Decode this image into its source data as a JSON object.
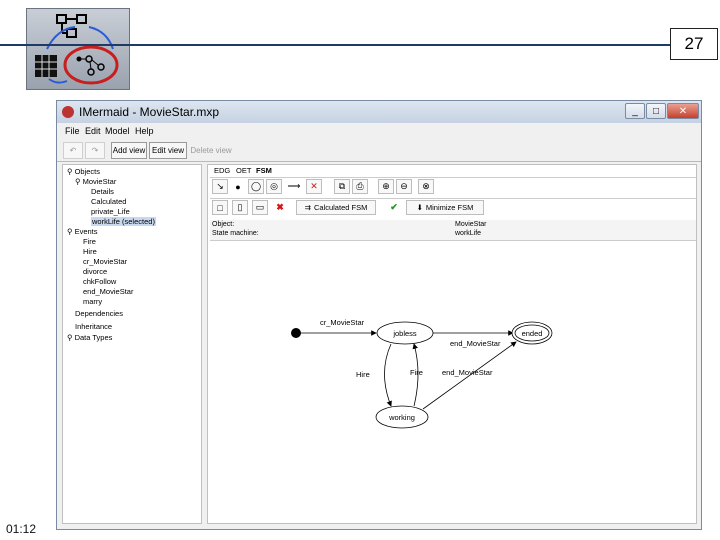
{
  "slide": {
    "page_number": "27",
    "time": "01:12",
    "logo_icon": "fsm-diagram-logo-icon"
  },
  "window": {
    "title": "IMermaid - MovieStar.mxp",
    "controls": {
      "minimize": "_",
      "maximize": "□",
      "close": "✕"
    },
    "menu": [
      "File",
      "Edit",
      "Model",
      "Help"
    ],
    "toolbar": {
      "undo": "↶",
      "redo": "↷",
      "add_view": "Add view",
      "edit_view": "Edit view",
      "delete_view": "Delete view"
    }
  },
  "tree": {
    "objects": "Objects",
    "moviestar": "MovieStar",
    "object_children": [
      "Details",
      "Calculated",
      "private_Life"
    ],
    "selected": "workLife (selected)",
    "events": "Events",
    "event_children": [
      "Fire",
      "Hire",
      "cr_MovieStar",
      "divorce",
      "chkFollow",
      "end_MovieStar",
      "marry"
    ],
    "dependencies": "Dependencies",
    "inheritance": "Inheritance",
    "data_types": "Data Types"
  },
  "editor": {
    "tabs": [
      "EDG",
      "OET",
      "FSM"
    ],
    "calc_fsm": "Calculated FSM",
    "minimize_fsm": "Minimize FSM",
    "info": {
      "object_label": "Object:",
      "object_value": "MovieStar",
      "sm_label": "State machine:",
      "sm_value": "workLife"
    }
  },
  "fsm": {
    "states": [
      "jobless",
      "ended",
      "working"
    ],
    "transitions": [
      "cr_MovieStar",
      "end_MovieStar",
      "end_MovieStar",
      "Hire",
      "Fire"
    ]
  }
}
